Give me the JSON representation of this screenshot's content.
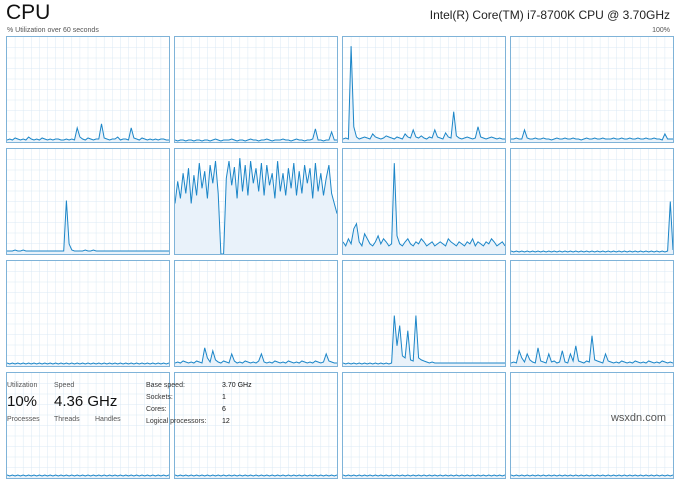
{
  "header": {
    "title": "CPU",
    "cpu_name": "Intel(R) Core(TM) i7-8700K CPU @ 3.70GHz",
    "axis_left": "% Utilization over 60 seconds",
    "axis_right": "100%"
  },
  "colors": {
    "line": "#1c86c8",
    "fill": "#e9f2fa",
    "border": "#7fb3d8",
    "grid": "#dbe9f4"
  },
  "chart_data": {
    "type": "area",
    "y_range": [
      0,
      100
    ],
    "series": [
      {
        "values": [
          2,
          3,
          2,
          4,
          3,
          2,
          3,
          2,
          5,
          3,
          2,
          3,
          2,
          4,
          3,
          2,
          3,
          2,
          3,
          3,
          2,
          2,
          3,
          2,
          3,
          2,
          14,
          5,
          3,
          2,
          4,
          3,
          2,
          3,
          3,
          18,
          4,
          3,
          2,
          3,
          3,
          5,
          2,
          3,
          3,
          2,
          14,
          4,
          3,
          2,
          4,
          3,
          2,
          3,
          2,
          3,
          2,
          3,
          3,
          2,
          2
        ]
      },
      {
        "values": [
          2,
          1,
          2,
          2,
          1,
          2,
          2,
          1,
          2,
          2,
          1,
          2,
          2,
          1,
          2,
          3,
          2,
          1,
          2,
          2,
          2,
          3,
          2,
          1,
          2,
          2,
          1,
          2,
          3,
          2,
          2,
          1,
          2,
          2,
          3,
          2,
          1,
          2,
          2,
          2,
          3,
          2,
          2,
          1,
          2,
          3,
          2,
          2,
          1,
          2,
          2,
          3,
          13,
          2,
          2,
          1,
          2,
          2,
          10,
          2,
          2
        ]
      },
      {
        "values": [
          3,
          4,
          3,
          95,
          15,
          5,
          3,
          4,
          5,
          4,
          3,
          8,
          5,
          4,
          3,
          4,
          6,
          5,
          4,
          3,
          5,
          4,
          3,
          8,
          5,
          4,
          12,
          5,
          4,
          6,
          4,
          3,
          5,
          4,
          12,
          5,
          4,
          3,
          9,
          5,
          4,
          30,
          6,
          4,
          3,
          4,
          5,
          4,
          3,
          4,
          15,
          5,
          4,
          3,
          4,
          5,
          4,
          3,
          4,
          3,
          3
        ]
      },
      {
        "values": [
          3,
          3,
          4,
          3,
          3,
          12,
          4,
          3,
          3,
          4,
          3,
          3,
          4,
          3,
          3,
          2,
          3,
          4,
          3,
          3,
          4,
          3,
          3,
          4,
          3,
          3,
          2,
          3,
          4,
          3,
          3,
          4,
          3,
          3,
          4,
          3,
          3,
          3,
          4,
          3,
          3,
          4,
          3,
          3,
          4,
          3,
          3,
          4,
          3,
          3,
          4,
          3,
          3,
          4,
          3,
          3,
          2,
          8,
          3,
          3,
          3
        ]
      },
      {
        "values": [
          3,
          3,
          3,
          4,
          3,
          3,
          4,
          3,
          3,
          3,
          3,
          3,
          3,
          3,
          3,
          3,
          3,
          3,
          3,
          3,
          3,
          3,
          53,
          10,
          4,
          3,
          3,
          3,
          3,
          4,
          3,
          3,
          4,
          3,
          3,
          3,
          3,
          3,
          3,
          3,
          3,
          3,
          3,
          3,
          3,
          3,
          3,
          3,
          3,
          3,
          3,
          3,
          3,
          3,
          3,
          3,
          3,
          3,
          3,
          3,
          3
        ]
      },
      {
        "values": [
          50,
          72,
          55,
          80,
          60,
          85,
          50,
          78,
          58,
          90,
          65,
          82,
          55,
          88,
          70,
          92,
          60,
          0,
          0,
          75,
          92,
          68,
          86,
          55,
          95,
          62,
          88,
          58,
          92,
          70,
          85,
          62,
          90,
          58,
          88,
          68,
          80,
          55,
          92,
          62,
          80,
          58,
          85,
          65,
          90,
          58,
          82,
          60,
          88,
          70,
          85,
          55,
          90,
          62,
          80,
          58,
          75,
          88,
          60,
          50,
          40
        ]
      },
      {
        "values": [
          12,
          8,
          15,
          10,
          25,
          30,
          12,
          8,
          20,
          15,
          10,
          8,
          12,
          18,
          10,
          15,
          12,
          8,
          10,
          90,
          18,
          10,
          8,
          12,
          15,
          10,
          8,
          12,
          10,
          15,
          12,
          8,
          10,
          12,
          8,
          10,
          12,
          10,
          8,
          15,
          12,
          10,
          8,
          12,
          10,
          8,
          12,
          10,
          15,
          8,
          12,
          10,
          8,
          12,
          10,
          15,
          12,
          8,
          10,
          12,
          8
        ]
      },
      {
        "values": [
          3,
          2,
          3,
          2,
          3,
          2,
          3,
          2,
          3,
          2,
          3,
          2,
          3,
          2,
          3,
          2,
          3,
          2,
          3,
          2,
          3,
          2,
          3,
          2,
          3,
          2,
          3,
          2,
          3,
          2,
          3,
          2,
          3,
          2,
          3,
          2,
          3,
          2,
          3,
          2,
          3,
          2,
          3,
          2,
          3,
          2,
          3,
          2,
          3,
          2,
          3,
          2,
          3,
          2,
          3,
          2,
          3,
          2,
          3,
          52,
          4
        ]
      },
      {
        "values": [
          3,
          2,
          3,
          2,
          3,
          2,
          3,
          2,
          3,
          2,
          3,
          2,
          3,
          2,
          3,
          2,
          3,
          2,
          3,
          2,
          3,
          2,
          3,
          2,
          3,
          2,
          3,
          2,
          3,
          2,
          3,
          2,
          3,
          2,
          3,
          2,
          3,
          2,
          3,
          2,
          3,
          2,
          3,
          2,
          3,
          2,
          3,
          2,
          3,
          2,
          3,
          2,
          3,
          2,
          3,
          2,
          3,
          2,
          3,
          2,
          3
        ]
      },
      {
        "values": [
          3,
          4,
          3,
          5,
          4,
          3,
          4,
          3,
          5,
          4,
          3,
          18,
          8,
          4,
          15,
          6,
          4,
          3,
          5,
          4,
          3,
          12,
          5,
          3,
          4,
          3,
          5,
          4,
          3,
          4,
          3,
          5,
          12,
          4,
          3,
          4,
          3,
          5,
          4,
          3,
          4,
          3,
          5,
          4,
          3,
          4,
          3,
          5,
          4,
          3,
          4,
          3,
          5,
          4,
          3,
          4,
          12,
          5,
          4,
          3,
          3
        ]
      },
      {
        "values": [
          3,
          2,
          3,
          2,
          3,
          2,
          3,
          2,
          3,
          2,
          3,
          2,
          3,
          2,
          3,
          2,
          3,
          2,
          3,
          50,
          20,
          40,
          10,
          8,
          35,
          6,
          5,
          50,
          8,
          6,
          5,
          4,
          3,
          4,
          3,
          3,
          3,
          3,
          3,
          3,
          3,
          3,
          3,
          3,
          3,
          3,
          3,
          3,
          3,
          3,
          3,
          3,
          3,
          3,
          3,
          3,
          3,
          3,
          3,
          3,
          3
        ]
      },
      {
        "values": [
          3,
          4,
          3,
          15,
          8,
          4,
          12,
          6,
          4,
          3,
          18,
          5,
          4,
          3,
          12,
          4,
          5,
          3,
          4,
          15,
          4,
          3,
          12,
          5,
          20,
          5,
          4,
          3,
          5,
          4,
          30,
          6,
          5,
          4,
          3,
          12,
          5,
          4,
          3,
          4,
          3,
          5,
          4,
          3,
          4,
          3,
          5,
          4,
          3,
          4,
          3,
          5,
          4,
          3,
          4,
          3,
          5,
          4,
          3,
          4,
          3
        ]
      },
      {
        "values": [
          3,
          2,
          3,
          2,
          3,
          2,
          3,
          2,
          3,
          2,
          3,
          2,
          3,
          2,
          3,
          2,
          3,
          2,
          3,
          2,
          3,
          2,
          3,
          2,
          3,
          2,
          3,
          2,
          3,
          2,
          3,
          2,
          3,
          2,
          3,
          2,
          3,
          2,
          3,
          2,
          3,
          2,
          3,
          2,
          3,
          2,
          3,
          2,
          3,
          2,
          3,
          2,
          3,
          2,
          3,
          2,
          3,
          2,
          3,
          2,
          3
        ]
      },
      {
        "values": [
          3,
          2,
          3,
          2,
          3,
          2,
          3,
          2,
          3,
          2,
          3,
          2,
          3,
          2,
          3,
          2,
          3,
          2,
          3,
          2,
          3,
          2,
          3,
          2,
          3,
          2,
          3,
          2,
          3,
          2,
          3,
          2,
          3,
          2,
          3,
          2,
          3,
          2,
          3,
          2,
          3,
          2,
          3,
          2,
          3,
          2,
          3,
          2,
          3,
          2,
          3,
          2,
          3,
          2,
          3,
          2,
          3,
          2,
          3,
          2,
          3
        ]
      },
      {
        "values": [
          3,
          2,
          3,
          2,
          3,
          2,
          3,
          2,
          3,
          2,
          3,
          2,
          3,
          2,
          3,
          2,
          3,
          2,
          3,
          2,
          3,
          2,
          3,
          2,
          3,
          2,
          3,
          2,
          3,
          2,
          3,
          2,
          3,
          2,
          3,
          2,
          3,
          2,
          3,
          2,
          3,
          2,
          3,
          2,
          3,
          2,
          3,
          2,
          3,
          2,
          3,
          2,
          3,
          2,
          3,
          2,
          3,
          2,
          3,
          2,
          3
        ]
      },
      {
        "values": [
          3,
          2,
          3,
          2,
          3,
          2,
          3,
          2,
          3,
          2,
          3,
          2,
          3,
          2,
          3,
          2,
          3,
          2,
          3,
          2,
          3,
          2,
          3,
          2,
          3,
          2,
          3,
          2,
          3,
          2,
          3,
          2,
          3,
          2,
          3,
          2,
          3,
          2,
          3,
          2,
          3,
          2,
          3,
          2,
          3,
          2,
          3,
          2,
          3,
          2,
          3,
          2,
          3,
          2,
          3,
          2,
          3,
          2,
          3,
          2,
          3
        ]
      }
    ]
  },
  "stats": {
    "utilization_label": "Utilization",
    "utilization_value": "10%",
    "speed_label": "Speed",
    "speed_value": "4.36 GHz",
    "processes_label": "Processes",
    "threads_label": "Threads",
    "handles_label": "Handles",
    "base_speed_label": "Base speed:",
    "base_speed_value": "3.70 GHz",
    "sockets_label": "Sockets:",
    "sockets_value": "1",
    "cores_label": "Cores:",
    "cores_value": "6",
    "logical_label": "Logical processors:",
    "logical_value": "12"
  },
  "watermark": "wsxdn.com"
}
